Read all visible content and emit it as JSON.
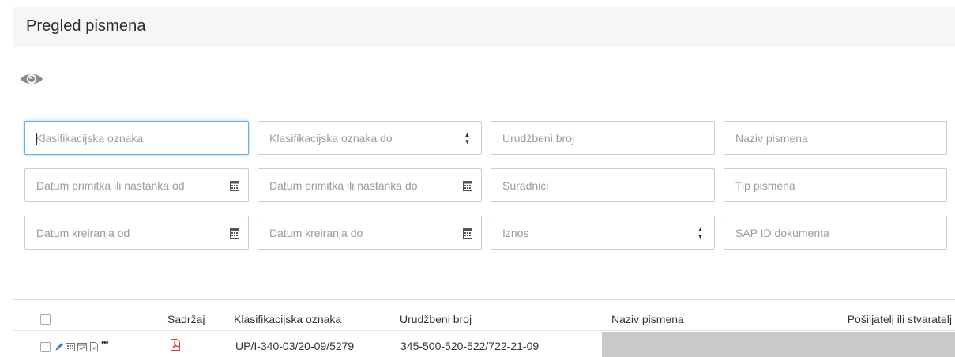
{
  "page": {
    "title": "Pregled pismena"
  },
  "toolbar": {
    "view_icon": "eye-icon"
  },
  "filters": {
    "klasifikacijska_oznaka": "Klasifikacijska oznaka",
    "klasifikacijska_oznaka_do": "Klasifikacijska oznaka do",
    "urudzbeni_broj": "Urudžbeni broj",
    "naziv_pismena": "Naziv pismena",
    "datum_primitka_od": "Datum primitka ili nastanka od",
    "datum_primitka_do": "Datum primitka ili nastanka do",
    "suradnici": "Suradnici",
    "tip_pismena": "Tip pismena",
    "datum_kreiranja_od": "Datum kreiranja od",
    "datum_kreiranja_do": "Datum kreiranja do",
    "iznos": "Iznos",
    "sap_id": "SAP ID dokumenta"
  },
  "table": {
    "columns": {
      "sadrzaj": "Sadržaj",
      "klasifikacijska_oznaka": "Klasifikacijska oznaka",
      "urudzbeni_broj": "Urudžbeni broj",
      "naziv_pismena": "Naziv pismena",
      "posiljatelj": "Pošiljatelj ili stvaratelj"
    },
    "rows": [
      {
        "klasifikacijska_oznaka": "UP/I-340-03/20-09/5279",
        "urudzbeni_broj": "345-500-520-522/722-21-09",
        "naziv_pismena": "",
        "attachment_icon": "pdf-icon",
        "more_label": "•••"
      }
    ]
  },
  "colors": {
    "focus": "#66afe9",
    "pdf": "#e0403a",
    "pencil": "#2f7fd0",
    "row_highlight": "#c9c9c9"
  }
}
